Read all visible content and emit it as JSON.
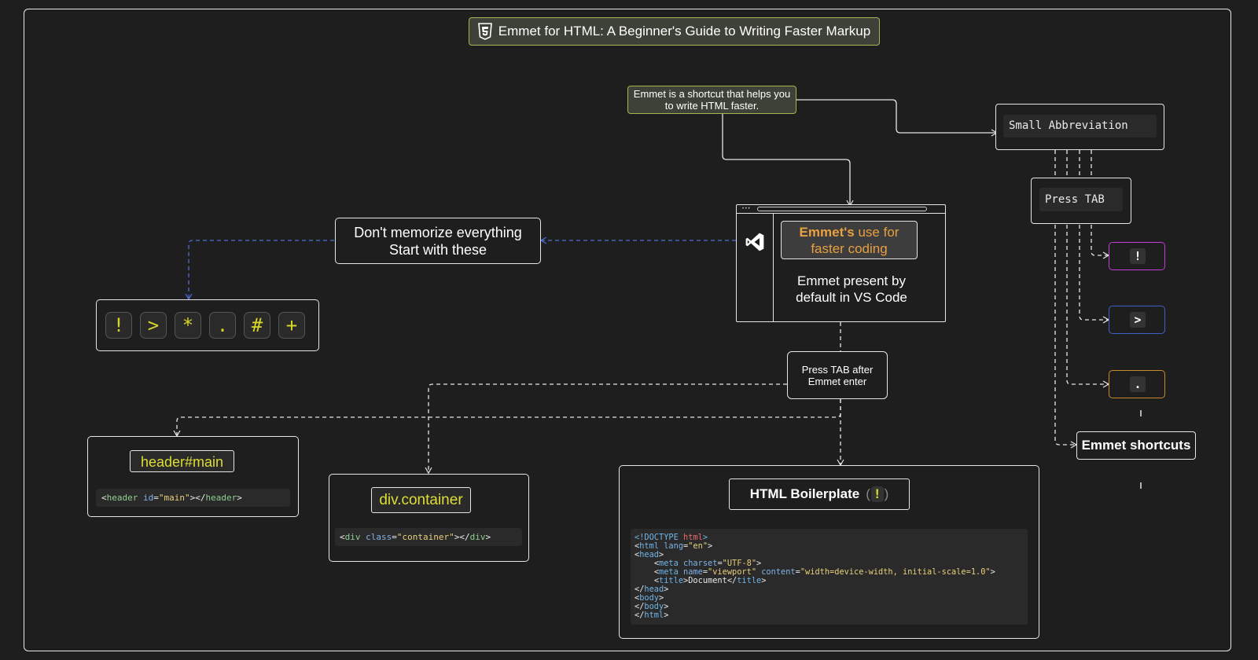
{
  "title": "Emmet for HTML: A Beginner's Guide to Writing Faster Markup",
  "intro_note": "Emmet is a shortcut that helps you to write HTML faster.",
  "vscode": {
    "highlight_brand": "Emmet's",
    "highlight_rest": " use for faster coding",
    "body": "Emmet present by default in VS Code"
  },
  "memorize": {
    "line1": "Don't memorize everything",
    "line2": "Start with these"
  },
  "symbols": [
    "!",
    ">",
    "*",
    ".",
    "#",
    "+"
  ],
  "press_tab_after": {
    "line1": "Press TAB after",
    "line2": "Emmet enter"
  },
  "header_example": {
    "abbr": "header#main",
    "code": {
      "open": "<",
      "tag": "header",
      "attr": " id",
      "eq": "=",
      "val": "\"main\"",
      "close": "></",
      "tag2": "header",
      "end": ">"
    }
  },
  "div_example": {
    "abbr": "div.container",
    "code": {
      "open": "<",
      "tag": "div",
      "attr": " class",
      "eq": "=",
      "val": "\"container\"",
      "close": "></",
      "tag2": "div",
      "end": ">"
    }
  },
  "boilerplate": {
    "heading": "HTML Boilerplate",
    "symbol": "!",
    "lines": [
      "<!DOCTYPE html>",
      "<html lang=\"en\">",
      "<head>",
      "    <meta charset=\"UTF-8\">",
      "    <meta name=\"viewport\" content=\"width=device-width, initial-scale=1.0\">",
      "    <title>Document</title>",
      "</head>",
      "<body>",
      "</body>",
      "</html>"
    ]
  },
  "right_flow": {
    "small_abbr": "Small Abbreviation",
    "press_tab": "Press TAB",
    "shortcut_symbols": [
      "!",
      ">",
      "."
    ],
    "shortcut_colors": [
      "#c23ed6",
      "#3a63c9",
      "#c98a2e"
    ],
    "emmet_shortcuts": "Emmet shortcuts"
  },
  "colors": {
    "accent_yellow": "#dede35",
    "blue_wire": "#4a6fd6",
    "orange": "#e8a040"
  }
}
